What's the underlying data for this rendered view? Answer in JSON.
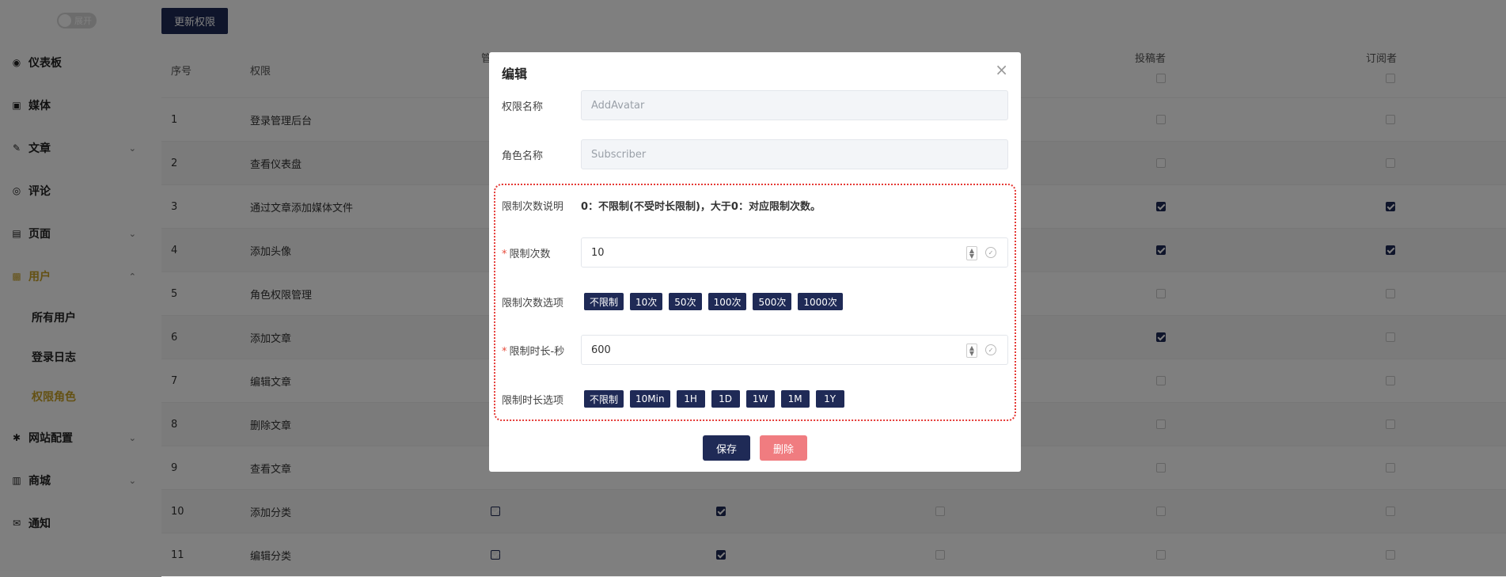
{
  "sidebar": {
    "toggle_label": "展开",
    "items": [
      {
        "label": "仪表板",
        "icon": "dashboard-icon",
        "glyph": "◉"
      },
      {
        "label": "媒体",
        "icon": "image-icon",
        "glyph": "▣"
      },
      {
        "label": "文章",
        "icon": "edit-icon",
        "glyph": "✎",
        "chev": "⌄"
      },
      {
        "label": "评论",
        "icon": "comment-icon",
        "glyph": "◎"
      },
      {
        "label": "页面",
        "icon": "page-icon",
        "glyph": "▤",
        "chev": "⌄"
      },
      {
        "label": "用户",
        "icon": "user-icon",
        "glyph": "▩",
        "chev": "⌃"
      },
      {
        "label": "网站配置",
        "icon": "gear-icon",
        "glyph": "✱",
        "chev": "⌄"
      },
      {
        "label": "商城",
        "icon": "shop-icon",
        "glyph": "▥",
        "chev": "⌄"
      },
      {
        "label": "通知",
        "icon": "mail-icon",
        "glyph": "✉"
      }
    ],
    "sub_items": [
      "所有用户",
      "登录日志",
      "权限角色"
    ]
  },
  "toolbar": {
    "update_label": "更新权限"
  },
  "table": {
    "headers": {
      "index": "序号",
      "permission": "权限",
      "col_admin": "管",
      "col_contributor": "投稿者",
      "col_subscriber": "订阅者"
    },
    "rows": [
      {
        "index": "1",
        "name": "登录管理后台"
      },
      {
        "index": "2",
        "name": "查看仪表盘"
      },
      {
        "index": "3",
        "name": "通过文章添加媒体文件"
      },
      {
        "index": "4",
        "name": "添加头像"
      },
      {
        "index": "5",
        "name": "角色权限管理"
      },
      {
        "index": "6",
        "name": "添加文章"
      },
      {
        "index": "7",
        "name": "编辑文章"
      },
      {
        "index": "8",
        "name": "删除文章"
      },
      {
        "index": "9",
        "name": "查看文章"
      },
      {
        "index": "10",
        "name": "添加分类"
      },
      {
        "index": "11",
        "name": "编辑分类"
      }
    ]
  },
  "modal": {
    "title": "编辑",
    "close_glyph": "×",
    "perm_name_label": "权限名称",
    "perm_name_value": "AddAvatar",
    "role_name_label": "角色名称",
    "role_name_value": "Subscriber",
    "limit_desc_label": "限制次数说明",
    "limit_desc_text": "0：不限制(不受时长限制)，大于0：对应限制次数。",
    "limit_count_label": "限制次数",
    "limit_count_value": "10",
    "limit_count_options_label": "限制次数选项",
    "limit_count_options": [
      "不限制",
      "10次",
      "50次",
      "100次",
      "500次",
      "1000次"
    ],
    "limit_duration_label": "限制时长-秒",
    "limit_duration_value": "600",
    "limit_duration_options_label": "限制时长选项",
    "limit_duration_options": [
      "不限制",
      "10Min",
      "1H",
      "1D",
      "1W",
      "1M",
      "1Y"
    ],
    "save_label": "保存",
    "delete_label": "删除"
  }
}
